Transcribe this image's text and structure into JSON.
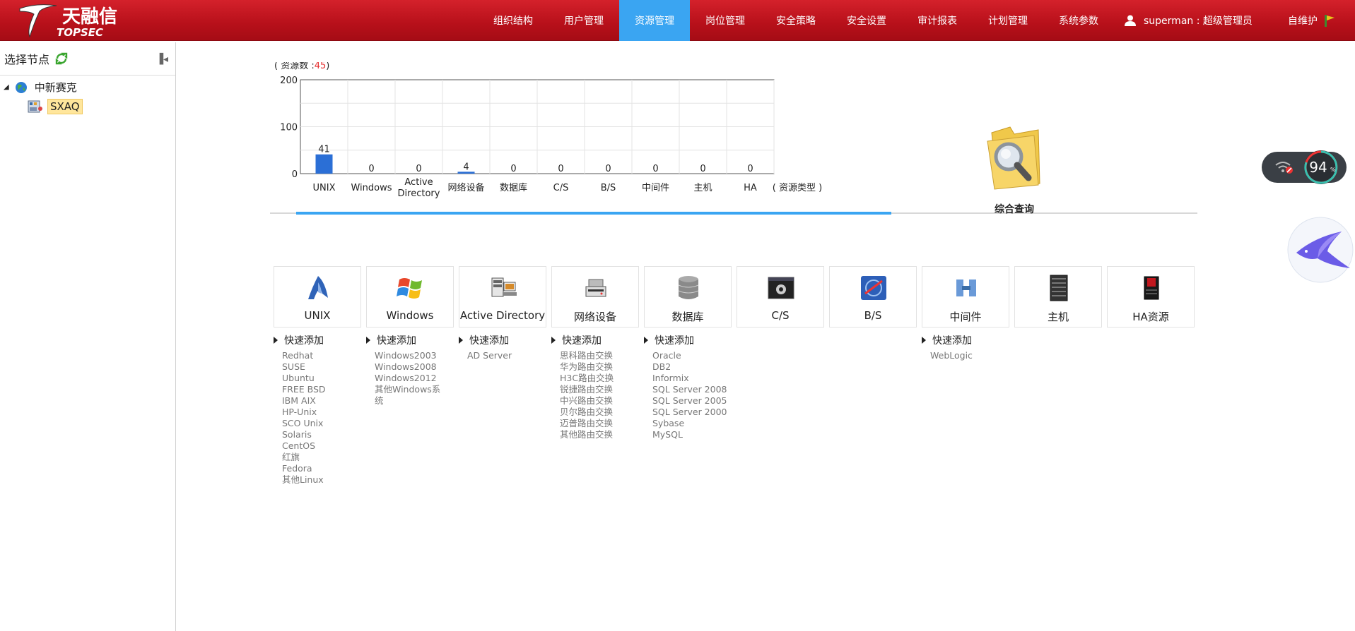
{
  "header": {
    "brand_cn": "天融信",
    "brand_en": "TOPSEC",
    "nav": [
      "组织结构",
      "用户管理",
      "资源管理",
      "岗位管理",
      "安全策略",
      "安全设置",
      "审计报表",
      "计划管理",
      "系统参数"
    ],
    "active_nav": "资源管理",
    "user": "superman : 超级管理员",
    "self_maintain": "自维护"
  },
  "sidebar": {
    "title": "选择节点",
    "tree": [
      {
        "label": "中新赛克",
        "icon": "globe-icon"
      },
      {
        "label": "SXAQ",
        "icon": "org-icon",
        "selected": true
      }
    ]
  },
  "chart_data": {
    "type": "bar",
    "caption_prefix": "( 资源数 :",
    "caption_count": "45",
    "caption_suffix": ")",
    "categories": [
      "UNIX",
      "Windows",
      "Active Directory",
      "网络设备",
      "数据库",
      "C/S",
      "B/S",
      "中间件",
      "主机",
      "HA"
    ],
    "values": [
      41,
      0,
      0,
      4,
      0,
      0,
      0,
      0,
      0,
      0
    ],
    "xlabel": "( 资源类型 )",
    "ylim": [
      0,
      200
    ],
    "yticks": [
      "0",
      "100",
      "200"
    ],
    "bar_color": "#2b6fd6",
    "grid": true
  },
  "query": {
    "label": "综合查询",
    "icon": "folder-search-icon"
  },
  "resource_cards": [
    {
      "name": "UNIX",
      "icon": "unix-icon",
      "quick_add": "快速添加",
      "items": [
        "Redhat",
        "SUSE",
        "Ubuntu",
        "FREE BSD",
        "IBM AIX",
        "HP-Unix",
        "SCO Unix",
        "Solaris",
        "CentOS",
        "红旗",
        "Fedora",
        "其他Linux"
      ]
    },
    {
      "name": "Windows",
      "icon": "windows-icon",
      "quick_add": "快速添加",
      "items": [
        "Windows2003",
        "Windows2008",
        "Windows2012",
        "其他Windows系统"
      ]
    },
    {
      "name": "Active Directory",
      "icon": "active-directory-icon",
      "quick_add": "快速添加",
      "items": [
        "AD Server"
      ]
    },
    {
      "name": "网络设备",
      "icon": "network-device-icon",
      "quick_add": "快速添加",
      "items": [
        "思科路由交换",
        "华为路由交换",
        "H3C路由交换",
        "锐捷路由交换",
        "中兴路由交换",
        "贝尔路由交换",
        "迈普路由交换",
        "其他路由交换"
      ]
    },
    {
      "name": "数据库",
      "icon": "database-icon",
      "quick_add": "快速添加",
      "items": [
        "Oracle",
        "DB2",
        "Informix",
        "SQL Server 2008",
        "SQL Server 2005",
        "SQL Server 2000",
        "Sybase",
        "MySQL"
      ]
    },
    {
      "name": "C/S",
      "icon": "cs-app-icon"
    },
    {
      "name": "B/S",
      "icon": "bs-app-icon"
    },
    {
      "name": "中间件",
      "icon": "middleware-icon",
      "quick_add": "快速添加",
      "items": [
        "WebLogic"
      ]
    },
    {
      "name": "主机",
      "icon": "host-server-icon"
    },
    {
      "name": "HA资源",
      "icon": "ha-resource-icon"
    }
  ],
  "widget": {
    "percent": "94",
    "unit": "%"
  },
  "colors": {
    "header": "#c4161f",
    "active_tab": "#3aa5f2",
    "accent_blue": "#3aa5f2"
  }
}
